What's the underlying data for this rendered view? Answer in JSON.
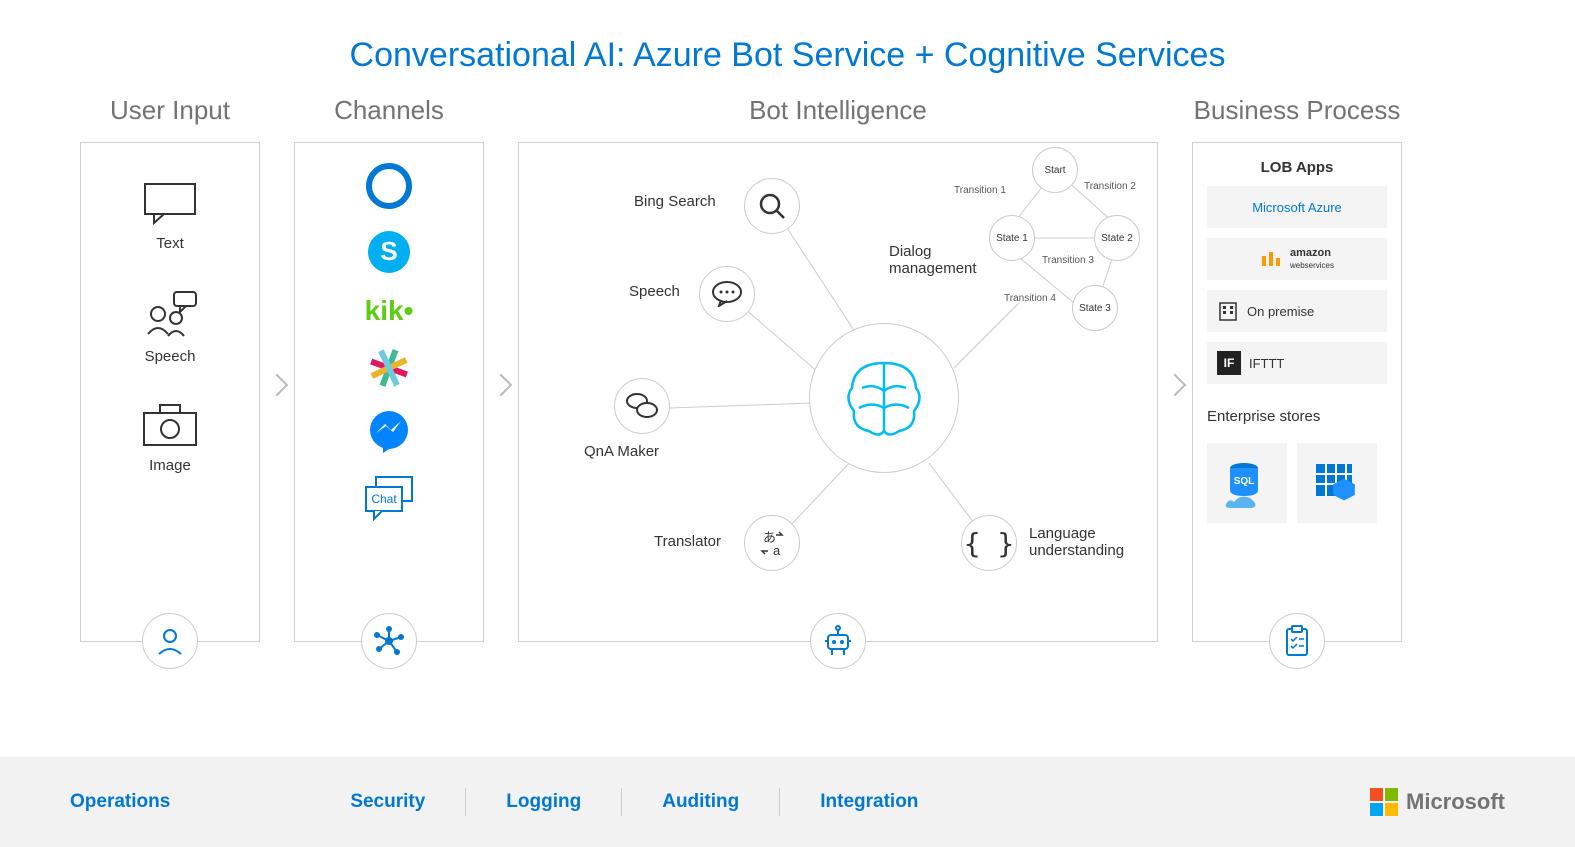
{
  "title": "Conversational AI: Azure Bot Service + Cognitive Services",
  "columns": {
    "user_input": {
      "header": "User Input",
      "items": [
        {
          "label": "Text",
          "icon": "chat-bubble-icon"
        },
        {
          "label": "Speech",
          "icon": "people-speech-icon"
        },
        {
          "label": "Image",
          "icon": "camera-icon"
        }
      ],
      "bottom_icon": "user-icon"
    },
    "channels": {
      "header": "Channels",
      "items": [
        "cortana-icon",
        "skype-icon",
        "kik-icon",
        "slack-icon",
        "messenger-icon",
        "webchat-icon"
      ],
      "bottom_icon": "hub-icon"
    },
    "bot_intelligence": {
      "header": "Bot Intelligence",
      "services": [
        {
          "label": "Bing Search",
          "icon": "search-icon"
        },
        {
          "label": "Speech",
          "icon": "speech-dots-icon"
        },
        {
          "label": "QnA Maker",
          "icon": "qna-icon"
        },
        {
          "label": "Translator",
          "icon": "translator-icon"
        },
        {
          "label": "Language understanding",
          "icon": "braces-icon"
        }
      ],
      "dialog": {
        "title": "Dialog management",
        "nodes": [
          "Start",
          "State 1",
          "State 2",
          "State 3"
        ],
        "transitions": [
          "Transition 1",
          "Transition 2",
          "Transition 3",
          "Transition 4"
        ]
      },
      "center_icon": "brain-icon",
      "bottom_icon": "robot-icon"
    },
    "business_process": {
      "header": "Business Process",
      "lob_title": "LOB Apps",
      "lob_items": [
        {
          "label": "Microsoft Azure",
          "icon": "azure-icon",
          "color": "#0078d4"
        },
        {
          "label": "amazon webservices",
          "icon": "aws-icon",
          "color": "#333"
        },
        {
          "label": "On premise",
          "icon": "building-icon",
          "color": "#333"
        },
        {
          "label": "IFTTT",
          "icon": "ifttt-icon",
          "color": "#333"
        }
      ],
      "enterprise_title": "Enterprise stores",
      "enterprise_tiles": [
        "sql-cloud-icon",
        "calendar-db-icon"
      ],
      "bottom_icon": "clipboard-icon"
    }
  },
  "footer": {
    "links": [
      "Operations",
      "Security",
      "Logging",
      "Auditing",
      "Integration"
    ],
    "brand": "Microsoft"
  }
}
